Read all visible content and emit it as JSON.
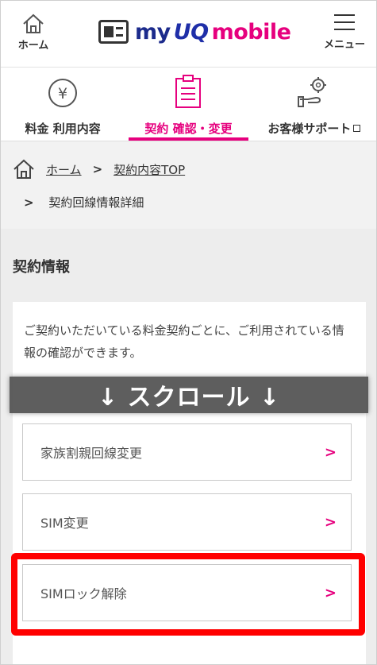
{
  "header": {
    "home_label": "ホーム",
    "logo_my": "my",
    "logo_uq": "UQ",
    "logo_mobile": "mobile",
    "menu_label": "メニュー"
  },
  "tabs": [
    {
      "label": "料金 利用内容",
      "icon": "yen-coin-icon"
    },
    {
      "label": "契約 確認・変更",
      "icon": "clipboard-icon",
      "active": true
    },
    {
      "label": "お客様サポート",
      "icon": "support-gear-hand-icon",
      "external": true
    }
  ],
  "breadcrumb": {
    "home": "ホーム",
    "contract_top": "契約内容TOP",
    "current": "契約回線情報詳細",
    "separator": ">"
  },
  "section": {
    "title": "契約情報",
    "description": "ご契約いただいている料金契約ごとに、ご利用されている情報の確認ができます。"
  },
  "overlay": {
    "scroll_text": "↓ スクロール ↓"
  },
  "menu_items": [
    {
      "label": "家族割親回線変更"
    },
    {
      "label": "SIM変更"
    },
    {
      "label": "SIMロック解除"
    }
  ],
  "colors": {
    "accent": "#e6007e",
    "highlight": "#ff0000",
    "brand_blue": "#1c2b8c"
  }
}
